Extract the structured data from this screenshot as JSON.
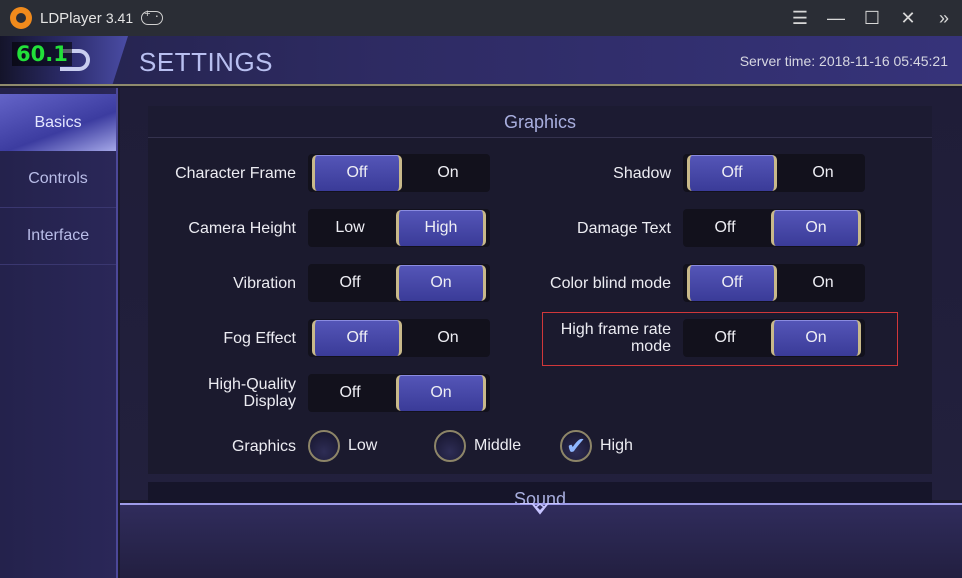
{
  "titlebar": {
    "app_name": "LDPlayer",
    "version": "3.41",
    "controls": [
      "menu-icon",
      "minimize-icon",
      "maximize-icon",
      "close-icon",
      "expand-sidebar-icon"
    ]
  },
  "header": {
    "fps": "60.1",
    "title": "SETTINGS",
    "server_time": "Server time: 2018-11-16 05:45:21"
  },
  "sidebar": {
    "items": [
      {
        "label": "Basics",
        "active": true
      },
      {
        "label": "Controls",
        "active": false
      },
      {
        "label": "Interface",
        "active": false
      }
    ]
  },
  "graphics": {
    "title": "Graphics",
    "left": [
      {
        "label": "Character Frame",
        "options": [
          "Off",
          "On"
        ],
        "selected": 0
      },
      {
        "label": "Camera Height",
        "options": [
          "Low",
          "High"
        ],
        "selected": 1
      },
      {
        "label": "Vibration",
        "options": [
          "Off",
          "On"
        ],
        "selected": 1
      },
      {
        "label": "Fog Effect",
        "options": [
          "Off",
          "On"
        ],
        "selected": 0
      },
      {
        "label": "High-Quality Display",
        "options": [
          "Off",
          "On"
        ],
        "selected": 1
      }
    ],
    "right": [
      {
        "label": "Shadow",
        "options": [
          "Off",
          "On"
        ],
        "selected": 0
      },
      {
        "label": "Damage Text",
        "options": [
          "Off",
          "On"
        ],
        "selected": 1
      },
      {
        "label": "Color blind mode",
        "options": [
          "Off",
          "On"
        ],
        "selected": 0
      },
      {
        "label": "High frame rate mode",
        "options": [
          "Off",
          "On"
        ],
        "selected": 1,
        "highlighted": true
      }
    ],
    "quality": {
      "label": "Graphics",
      "options": [
        "Low",
        "Middle",
        "High"
      ],
      "selected": 2
    }
  },
  "next_section": "Sound",
  "colors": {
    "selected_option": "#4a4ba8",
    "highlight_box": "#d0373a",
    "fps_text": "#22e03a",
    "logo": "#f08a1c"
  }
}
